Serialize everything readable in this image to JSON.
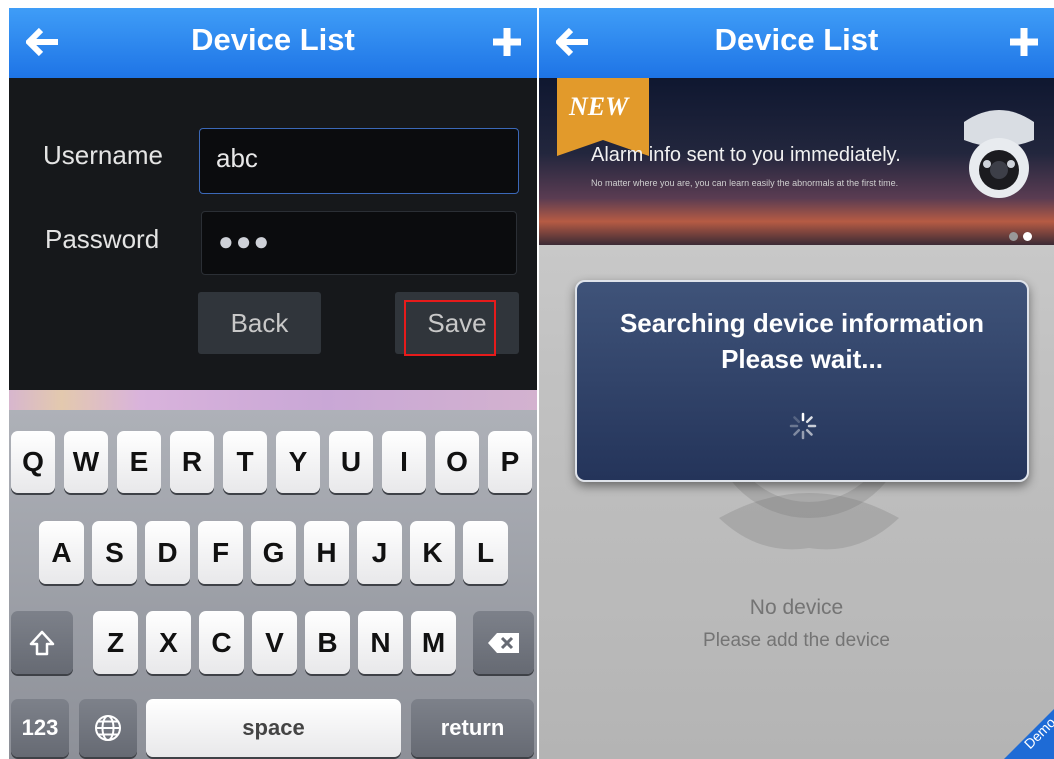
{
  "left": {
    "navbar": {
      "title": "Device List",
      "back_icon": "arrow-left-icon",
      "add_icon": "plus-icon"
    },
    "form": {
      "username_label": "Username",
      "username_value": "abc",
      "password_label": "Password",
      "password_value": "●●●",
      "back_label": "Back",
      "save_label": "Save"
    },
    "keyboard": {
      "row1": [
        "Q",
        "W",
        "E",
        "R",
        "T",
        "Y",
        "U",
        "I",
        "O",
        "P"
      ],
      "row2": [
        "A",
        "S",
        "D",
        "F",
        "G",
        "H",
        "J",
        "K",
        "L"
      ],
      "row3": [
        "Z",
        "X",
        "C",
        "V",
        "B",
        "N",
        "M"
      ],
      "numbers_label": "123",
      "space_label": "space",
      "return_label": "return",
      "shift_icon": "shift-icon",
      "delete_icon": "backspace-icon",
      "globe_icon": "globe-icon"
    }
  },
  "right": {
    "navbar": {
      "title": "Device List",
      "back_icon": "arrow-left-icon",
      "add_icon": "plus-icon"
    },
    "banner": {
      "badge": "NEW",
      "headline": "Alarm info sent to you immediately.",
      "subline": "No matter where you are, you can learn easily the abnormals at the first time."
    },
    "dialog": {
      "line1": "Searching device information",
      "line2": "Please wait..."
    },
    "empty_title": "No device",
    "empty_subtitle": "Please add the device",
    "corner_label": "Demo"
  },
  "colors": {
    "navbar": "#2c86ee",
    "highlight": "#e61b1b",
    "dialog": "#2f4268"
  }
}
